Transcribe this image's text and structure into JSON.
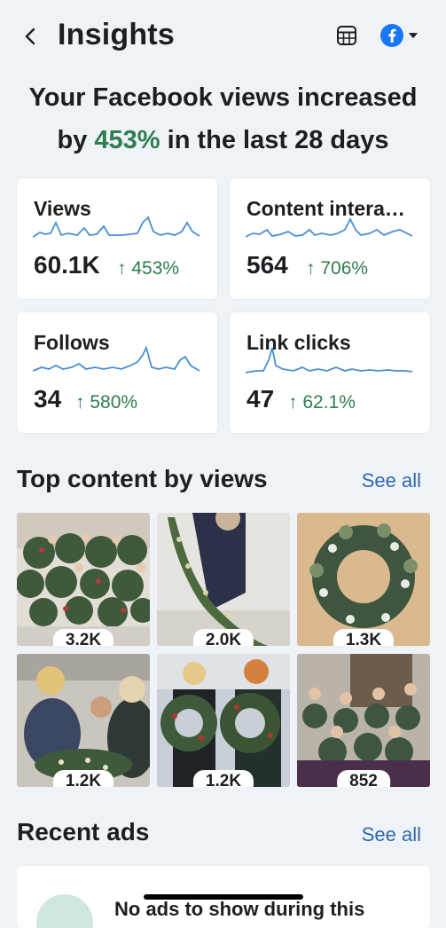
{
  "header": {
    "title": "Insights",
    "back_icon": "chevron-left-icon",
    "table_icon": "table-icon",
    "platform_icon": "facebook-icon",
    "caret_icon": "caret-down-icon",
    "brand_color": "#1877f2"
  },
  "headline": {
    "line1": "Your Facebook views increased",
    "line2_prefix": "by ",
    "percent": "453%",
    "line2_suffix": " in the last 28 days",
    "accent": "#2f7d4f"
  },
  "metrics": [
    {
      "title": "Views",
      "value": "60.1K",
      "arrow": "↑",
      "change": "453%"
    },
    {
      "title": "Content interactions",
      "value": "564",
      "arrow": "↑",
      "change": "706%"
    },
    {
      "title": "Follows",
      "value": "34",
      "arrow": "↑",
      "change": "580%"
    },
    {
      "title": "Link clicks",
      "value": "47",
      "arrow": "↑",
      "change": "62.1%"
    }
  ],
  "top_content": {
    "title": "Top content by views",
    "see_all": "See all",
    "items": [
      {
        "views": "3.2K"
      },
      {
        "views": "2.0K"
      },
      {
        "views": "1.3K"
      },
      {
        "views": "1.2K"
      },
      {
        "views": "1.2K"
      },
      {
        "views": "852"
      }
    ]
  },
  "recent_ads": {
    "title": "Recent ads",
    "see_all": "See all",
    "empty_text": "No ads to show during this"
  },
  "colors": {
    "positive": "#2f7d4f",
    "link": "#2f68b0",
    "sparkline": "#4a8fd0"
  }
}
